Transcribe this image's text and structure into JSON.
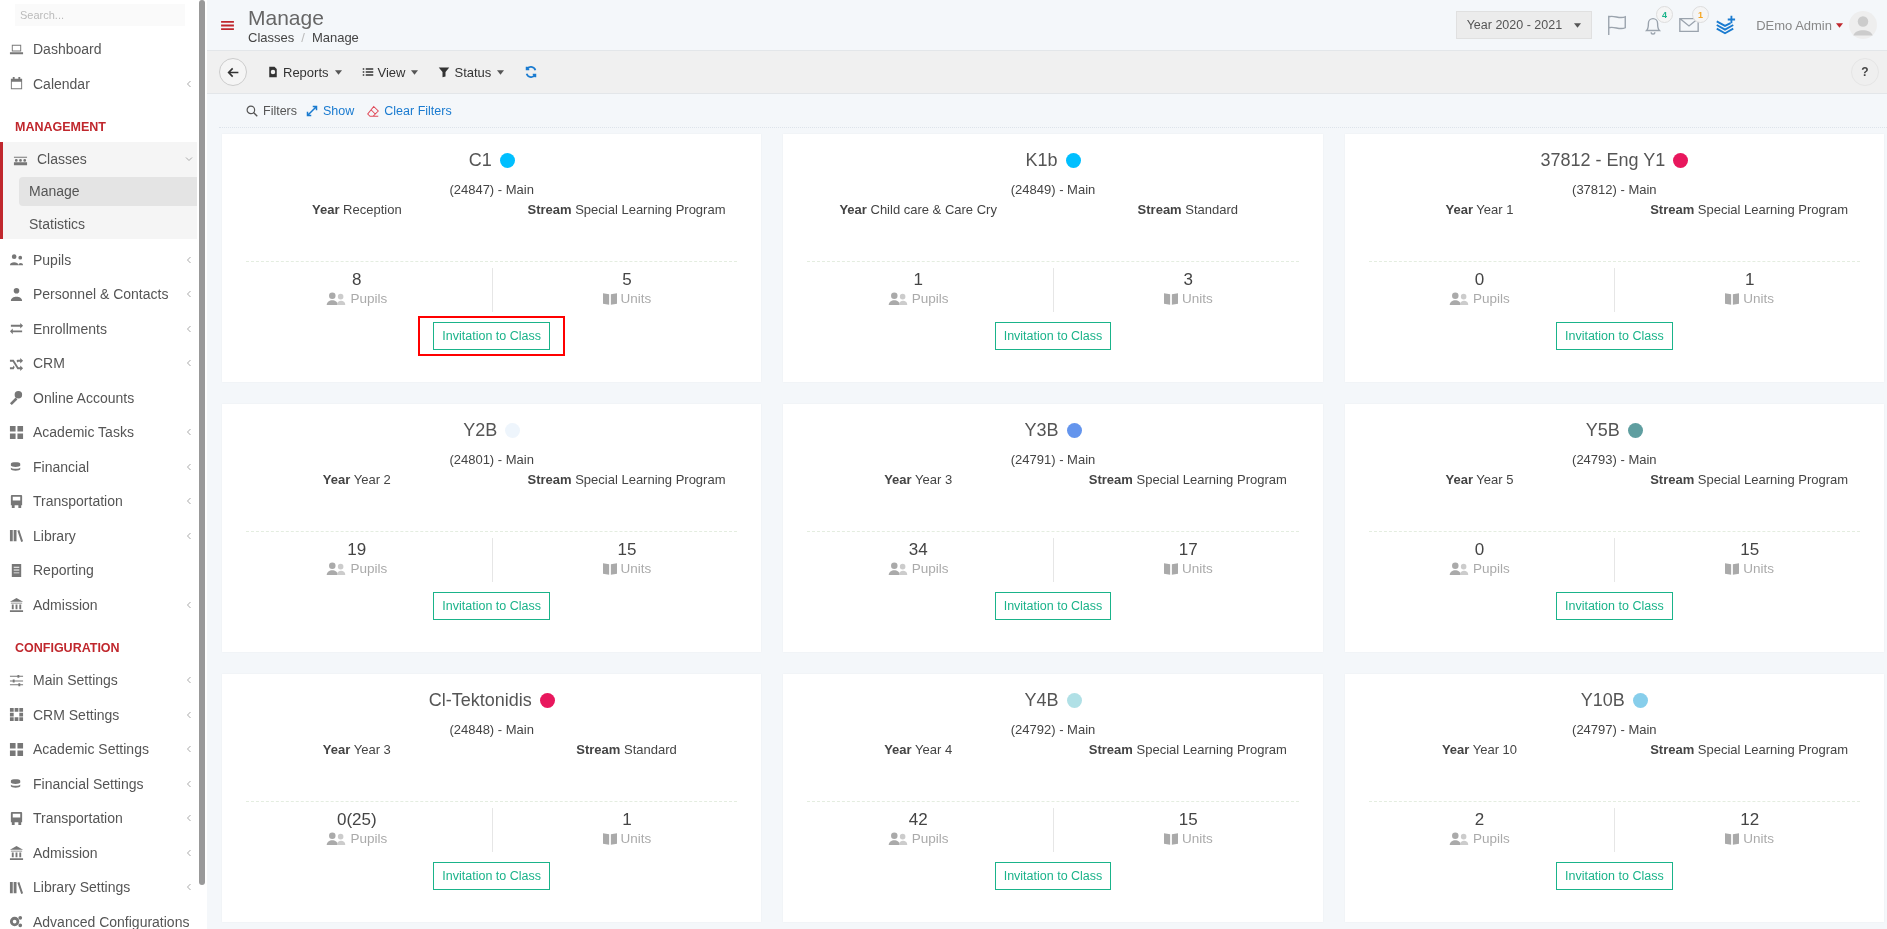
{
  "sidebar": {
    "search": {
      "placeholder": "Search..."
    },
    "items": [
      {
        "kind": "link",
        "label": "Dashboard",
        "selected": false
      },
      {
        "kind": "link",
        "label": "Calendar",
        "selected": false,
        "expanded": false
      },
      {
        "kind": "section",
        "label": "MANAGEMENT"
      },
      {
        "kind": "link",
        "label": "Classes",
        "selected": true,
        "expanded": true,
        "children": [
          {
            "label": "Manage",
            "selected": true
          },
          {
            "label": "Statistics",
            "selected": false
          }
        ]
      },
      {
        "kind": "link",
        "label": "Pupils",
        "selected": false,
        "expanded": false
      },
      {
        "kind": "link",
        "label": "Personnel & Contacts",
        "selected": false,
        "expanded": false
      },
      {
        "kind": "link",
        "label": "Enrollments",
        "selected": false,
        "expanded": false
      },
      {
        "kind": "link",
        "label": "CRM",
        "selected": false,
        "expanded": false
      },
      {
        "kind": "link",
        "label": "Online Accounts",
        "selected": false
      },
      {
        "kind": "link",
        "label": "Academic Tasks",
        "selected": false,
        "expanded": false
      },
      {
        "kind": "link",
        "label": "Financial",
        "selected": false,
        "expanded": false
      },
      {
        "kind": "link",
        "label": "Transportation",
        "selected": false,
        "expanded": false
      },
      {
        "kind": "link",
        "label": "Library",
        "selected": false,
        "expanded": false
      },
      {
        "kind": "link",
        "label": "Reporting",
        "selected": false
      },
      {
        "kind": "link",
        "label": "Admission",
        "selected": false,
        "expanded": false
      },
      {
        "kind": "section",
        "label": "CONFIGURATION"
      },
      {
        "kind": "link",
        "label": "Main Settings",
        "selected": false,
        "expanded": false
      },
      {
        "kind": "link",
        "label": "CRM Settings",
        "selected": false,
        "expanded": false
      },
      {
        "kind": "link",
        "label": "Academic Settings",
        "selected": false,
        "expanded": false
      },
      {
        "kind": "link",
        "label": "Financial Settings",
        "selected": false,
        "expanded": false
      },
      {
        "kind": "link",
        "label": "Transportation",
        "selected": false,
        "expanded": false
      },
      {
        "kind": "link",
        "label": "Admission",
        "selected": false,
        "expanded": false
      },
      {
        "kind": "link",
        "label": "Library Settings",
        "selected": false,
        "expanded": false
      },
      {
        "kind": "link",
        "label": "Advanced Configurations",
        "selected": false
      }
    ]
  },
  "header": {
    "title": "Manage",
    "breadcrumb": [
      "Classes",
      "Manage"
    ],
    "breadcrumb_separator": "/",
    "year_select": "Year 2020 - 2021",
    "notifications_badge": "4",
    "messages_badge": "1",
    "user": "DEmo Admin"
  },
  "toolbar": {
    "buttons": [
      "Reports",
      "View",
      "Status"
    ],
    "help": "?"
  },
  "filters": {
    "label": "Filters",
    "show": "Show",
    "clear": "Clear Filters"
  },
  "cards": [
    {
      "name": "C1",
      "color": "#00bfff",
      "code": "(24847) - Main",
      "year": "**Year** Reception",
      "stream": "**Stream** Special Learning Program",
      "pupils": "8",
      "pupils_label": "Pupils",
      "units": "5",
      "units_label": "Units",
      "button": "Invitation to Class",
      "highlighted": true
    },
    {
      "name": "K1b",
      "color": "#00bfff",
      "code": "(24849) - Main",
      "year": "**Year** Child care & Care Cry",
      "stream": "**Stream** Standard",
      "pupils": "1",
      "pupils_label": "Pupils",
      "units": "3",
      "units_label": "Units",
      "button": "Invitation to Class",
      "highlighted": false
    },
    {
      "name": "37812 - Eng Y1",
      "color": "#e8175d",
      "code": "(37812) - Main",
      "year": "**Year** Year 1",
      "stream": "**Stream** Special Learning Program",
      "pupils": "0",
      "pupils_label": "Pupils",
      "units": "1",
      "units_label": "Units",
      "button": "Invitation to Class",
      "highlighted": false
    },
    {
      "name": "Y2B",
      "color": "#eef5fc",
      "code": "(24801) - Main",
      "year": "**Year** Year 2",
      "stream": "**Stream** Special Learning Program",
      "pupils": "19",
      "pupils_label": "Pupils",
      "units": "15",
      "units_label": "Units",
      "button": "Invitation to Class",
      "highlighted": false
    },
    {
      "name": "Y3B",
      "color": "#6495ed",
      "code": "(24791) - Main",
      "year": "**Year** Year 3",
      "stream": "**Stream** Special Learning Program",
      "pupils": "34",
      "pupils_label": "Pupils",
      "units": "17",
      "units_label": "Units",
      "button": "Invitation to Class",
      "highlighted": false
    },
    {
      "name": "Y5B",
      "color": "#5f9ea0",
      "code": "(24793) - Main",
      "year": "**Year** Year 5",
      "stream": "**Stream** Special Learning Program",
      "pupils": "0",
      "pupils_label": "Pupils",
      "units": "15",
      "units_label": "Units",
      "button": "Invitation to Class",
      "highlighted": false
    },
    {
      "name": "Cl-Tektonidis",
      "color": "#e8175d",
      "code": "(24848) - Main",
      "year": "**Year** Year 3",
      "stream": "**Stream** Standard",
      "pupils": "0(25)",
      "pupils_label": "Pupils",
      "units": "1",
      "units_label": "Units",
      "button": "Invitation to Class",
      "highlighted": false
    },
    {
      "name": "Y4B",
      "color": "#b0e0e6",
      "code": "(24792) - Main",
      "year": "**Year** Year 4",
      "stream": "**Stream** Special Learning Program",
      "pupils": "42",
      "pupils_label": "Pupils",
      "units": "15",
      "units_label": "Units",
      "button": "Invitation to Class",
      "highlighted": false
    },
    {
      "name": "Y10B",
      "color": "#87ceeb",
      "code": "(24797) - Main",
      "year": "**Year** Year 10",
      "stream": "**Stream** Special Learning Program",
      "pupils": "2",
      "pupils_label": "Pupils",
      "units": "12",
      "units_label": "Units",
      "button": "Invitation to Class",
      "highlighted": false
    }
  ]
}
